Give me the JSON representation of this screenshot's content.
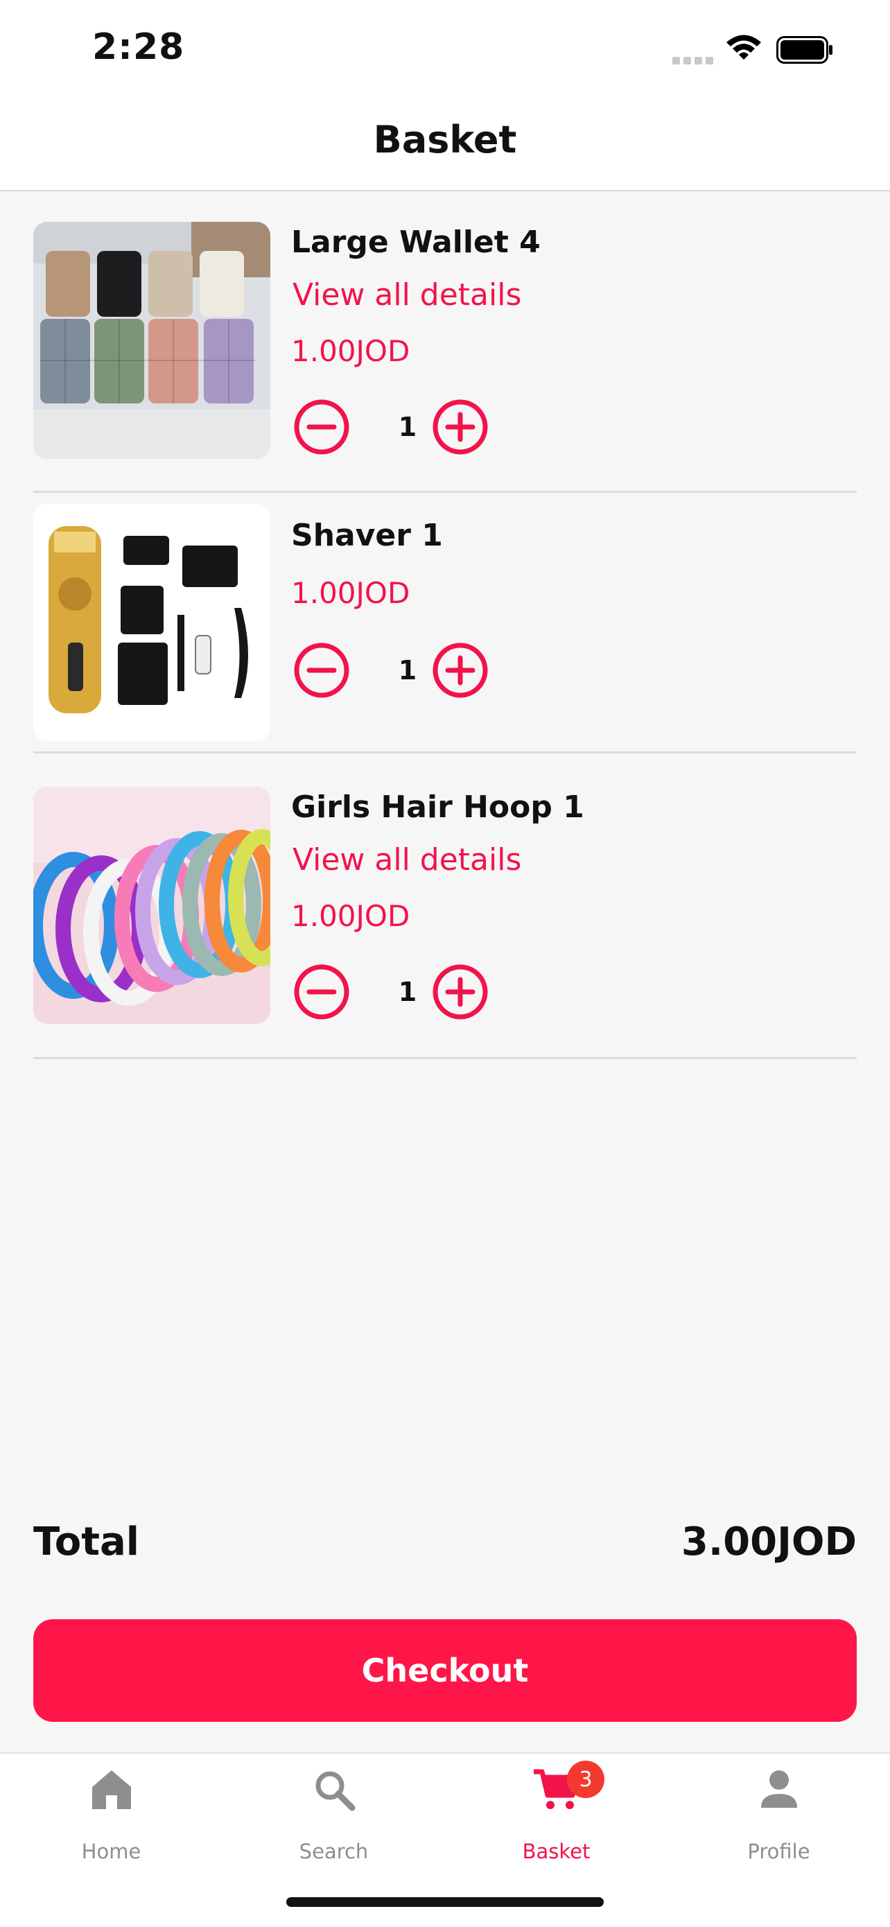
{
  "status_bar": {
    "time": "2:28"
  },
  "header": {
    "title": "Basket"
  },
  "cart": {
    "items": [
      {
        "name": "Large Wallet 4",
        "details_link": "View all details",
        "price": "1.00JOD",
        "quantity": "1",
        "image": "wallets-photo"
      },
      {
        "name": "Shaver 1",
        "price": "1.00JOD",
        "quantity": "1",
        "image": "shaver-kit-photo"
      },
      {
        "name": "Girls Hair Hoop 1",
        "details_link": "View all details",
        "price": "1.00JOD",
        "quantity": "1",
        "image": "hair-hoops-photo"
      }
    ]
  },
  "summary": {
    "total_label": "Total",
    "total_value": "3.00JOD"
  },
  "checkout": {
    "label": "Checkout"
  },
  "tabs": [
    {
      "label": "Home",
      "icon": "home-icon"
    },
    {
      "label": "Search",
      "icon": "search-icon"
    },
    {
      "label": "Basket",
      "icon": "cart-icon",
      "badge": "3",
      "active": true
    },
    {
      "label": "Profile",
      "icon": "person-icon"
    }
  ],
  "colors": {
    "accent": "#ff1648",
    "badge": "#f43a2f",
    "inactive": "#8e8e8e"
  }
}
